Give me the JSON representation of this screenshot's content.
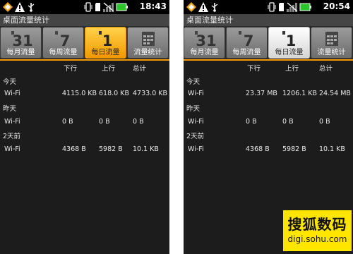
{
  "left": {
    "status": {
      "time": "18:43"
    },
    "app_title": "桌面流量统计",
    "tabs": [
      {
        "icon_text": "31",
        "label": "每月流量"
      },
      {
        "icon_text": "7",
        "label": "每周流量"
      },
      {
        "icon_text": "1",
        "label": "每日流量",
        "selected": true
      },
      {
        "icon_text": "",
        "label": "流量统计"
      }
    ],
    "columns": [
      "下行",
      "上行",
      "总计"
    ],
    "sections": [
      {
        "title": "今天",
        "rows": [
          {
            "name": "Wi-Fi",
            "down": "4115.0 KB",
            "up": "618.0 KB",
            "total": "4733.0 KB"
          }
        ]
      },
      {
        "title": "昨天",
        "rows": [
          {
            "name": "Wi-Fi",
            "down": "0 B",
            "up": "0 B",
            "total": "0 B"
          }
        ]
      },
      {
        "title": "2天前",
        "rows": [
          {
            "name": "Wi-Fi",
            "down": "4368 B",
            "up": "5982 B",
            "total": "10.1 KB"
          }
        ]
      }
    ]
  },
  "right": {
    "status": {
      "time": "20:54"
    },
    "app_title": "桌面流量统计",
    "tabs": [
      {
        "icon_text": "31",
        "label": "每月流量"
      },
      {
        "icon_text": "7",
        "label": "每周流量"
      },
      {
        "icon_text": "1",
        "label": "每日流量",
        "selected": true
      },
      {
        "icon_text": "",
        "label": "流量统计"
      }
    ],
    "columns": [
      "下行",
      "上行",
      "总计"
    ],
    "sections": [
      {
        "title": "今天",
        "rows": [
          {
            "name": "Wi-Fi",
            "down": "23.37 MB",
            "up": "1206.1 KB",
            "total": "24.54 MB"
          }
        ]
      },
      {
        "title": "昨天",
        "rows": [
          {
            "name": "Wi-Fi",
            "down": "0 B",
            "up": "0 B",
            "total": "0 B"
          }
        ]
      },
      {
        "title": "2天前",
        "rows": [
          {
            "name": "Wi-Fi",
            "down": "4368 B",
            "up": "5982 B",
            "total": "10.1 KB"
          }
        ]
      }
    ]
  },
  "watermark": {
    "text": "搜狐数码",
    "url": "digi.sohu.com"
  },
  "colors": {
    "accent_orange": "#f29a00",
    "background": "#1c1c1c",
    "tab_gray": "#7f7f7f",
    "watermark_yellow": "#ffe600"
  },
  "icons": [
    "warning-icon",
    "usb-icon",
    "vibrate-icon",
    "sd-card-icon",
    "no-signal-icon",
    "battery-icon",
    "calendar-icon"
  ]
}
